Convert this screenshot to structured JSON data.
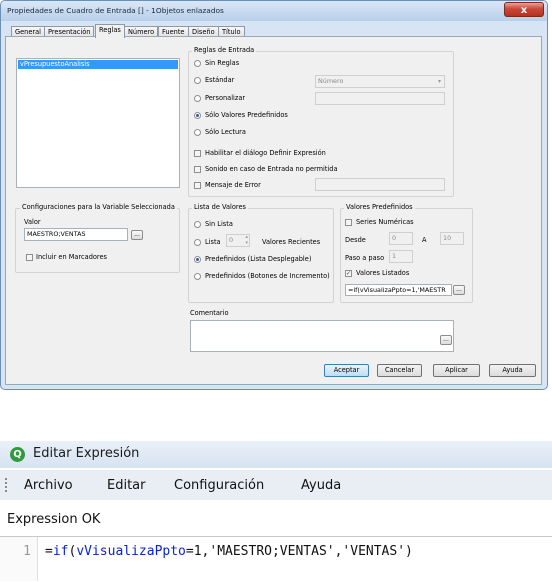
{
  "dialog1": {
    "title": "Propiedades de Cuadro de Entrada [] - 1Objetos enlazados",
    "close_label": "x",
    "tabs": [
      "General",
      "Presentación",
      "Reglas",
      "Número",
      "Fuente",
      "Diseño",
      "Título"
    ],
    "active_tab": "Reglas",
    "variables_list": [
      "vPresupuestoAnalisis"
    ],
    "rules_group": {
      "label": "Reglas de Entrada",
      "options": [
        "Sin Reglas",
        "Estándar",
        "Personalizar",
        "Sólo Valores Predefinidos",
        "Sólo Lectura"
      ],
      "selected": "Sólo Valores Predefinidos",
      "standard_select_value": "Número",
      "checkboxes": [
        "Habilitar el diálogo Definir Expresión",
        "Sonido en caso de Entrada no permitida",
        "Mensaje de Error"
      ]
    },
    "config_group": {
      "label": "Configuraciones para la Variable Seleccionada",
      "value_label": "Valor",
      "value": "MAESTRO;VENTAS",
      "include_bookmarks_label": "Incluir en Marcadores"
    },
    "values_list_group": {
      "label": "Lista de Valores",
      "no_list": "Sin Lista",
      "list": "Lista",
      "list_count": "0",
      "recent_values": "Valores Recientes",
      "predefined_dropdown": "Predefinidos (Lista Desplegable)",
      "predefined_buttons": "Predefinidos (Botones de Incremento)",
      "selected": "Predefinidos (Lista Desplegable)"
    },
    "predefined_group": {
      "label": "Valores Predefinidos",
      "numeric_series": "Series Numéricas",
      "from_label": "Desde",
      "from_value": "0",
      "to_label": "A",
      "to_value": "10",
      "step_label": "Paso a paso",
      "step_value": "1",
      "listed_values": "Valores Listados",
      "listed_expression": "=if(vVisualizaPpto=1,'MAESTR"
    },
    "comment_label": "Comentario",
    "buttons": {
      "ok": "Aceptar",
      "cancel": "Cancelar",
      "apply": "Aplicar",
      "help": "Ayuda"
    },
    "ellipsis": "..."
  },
  "dialog2": {
    "app_icon_letter": "Q",
    "title": "Editar Expresión",
    "menu": [
      "Archivo",
      "Editar",
      "Configuración",
      "Ayuda"
    ],
    "status": "Expression OK",
    "line_number": "1",
    "code": {
      "prefix": "=",
      "fn": "if",
      "paren_open": "(",
      "var": "vVisualizaPpto",
      "rest": "=1,'MAESTRO;VENTAS','VENTAS')"
    }
  },
  "colors": {
    "keyword": "#0b25c9",
    "title_bar": "#c5d8ee",
    "close_button": "#c9483a",
    "app_icon": "#2f9a3d"
  }
}
